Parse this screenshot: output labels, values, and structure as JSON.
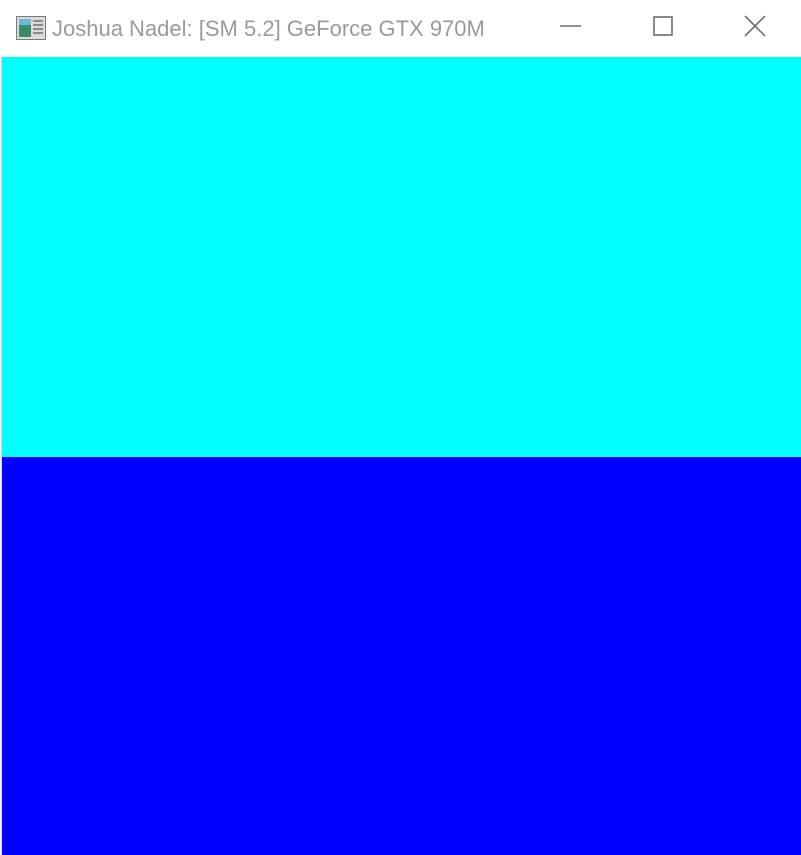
{
  "window": {
    "title": "Joshua Nadel: [SM 5.2] GeForce GTX 970M",
    "app_icon": "window-app-icon",
    "controls": {
      "minimize_icon": "minimize-icon",
      "maximize_icon": "maximize-icon",
      "close_icon": "close-icon"
    }
  },
  "render_output": {
    "top_band_color": "#00FFFF",
    "bottom_band_color": "#0000FF"
  },
  "colors": {
    "titlebar_bg": "#FFFFFF",
    "title_text": "#9A9A9A",
    "caption_glyph": "#6E6E6E"
  }
}
